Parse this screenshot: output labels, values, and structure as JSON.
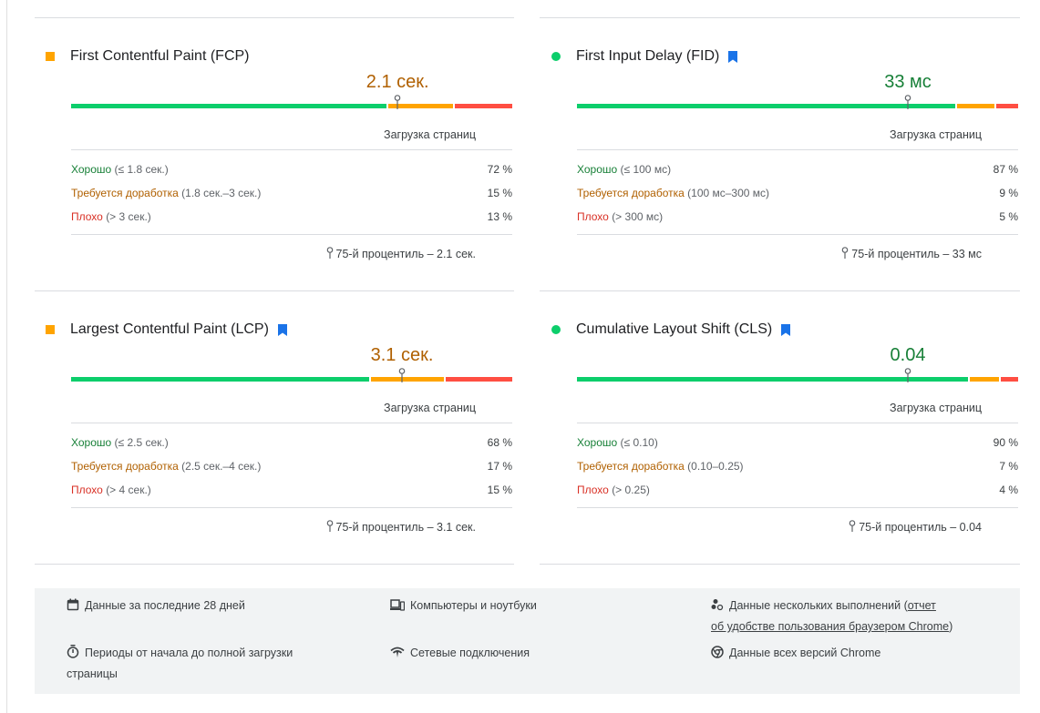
{
  "colors": {
    "good": "#0cce6b",
    "needs_improvement": "#ffa400",
    "poor": "#ff4e42",
    "bookmark": "#1a73e8"
  },
  "column_header": "Загрузка страниц",
  "cards": [
    {
      "title": "First Contentful Paint (FCP)",
      "status": "needs_improvement",
      "bookmark": false,
      "value": "2.1 сек.",
      "dist": {
        "good": 0.72,
        "needs_improvement": 0.15,
        "poor": 0.13,
        "marker": 0.74
      },
      "rows": [
        {
          "label": "Хорошо",
          "range": "(≤ 1.8 сек.)",
          "pct": "72 %"
        },
        {
          "label": "Требуется доработка",
          "range": "(1.8 сек.–3 сек.)",
          "pct": "15 %"
        },
        {
          "label": "Плохо",
          "range": "(> 3 сек.)",
          "pct": "13 %"
        }
      ],
      "percentile": "75-й процентиль – 2.1 сек."
    },
    {
      "title": "First Input Delay (FID)",
      "status": "good",
      "bookmark": true,
      "value": "33 мс",
      "dist": {
        "good": 0.87,
        "needs_improvement": 0.09,
        "poor": 0.05,
        "marker": 0.75
      },
      "rows": [
        {
          "label": "Хорошо",
          "range": "(≤ 100 мс)",
          "pct": "87 %"
        },
        {
          "label": "Требуется доработка",
          "range": "(100 мс–300 мс)",
          "pct": "9 %"
        },
        {
          "label": "Плохо",
          "range": "(> 300 мс)",
          "pct": "5 %"
        }
      ],
      "percentile": "75-й процентиль – 33 мс"
    },
    {
      "title": "Largest Contentful Paint (LCP)",
      "status": "needs_improvement",
      "bookmark": true,
      "value": "3.1 сек.",
      "dist": {
        "good": 0.68,
        "needs_improvement": 0.17,
        "poor": 0.15,
        "marker": 0.75
      },
      "rows": [
        {
          "label": "Хорошо",
          "range": "(≤ 2.5 сек.)",
          "pct": "68 %"
        },
        {
          "label": "Требуется доработка",
          "range": "(2.5 сек.–4 сек.)",
          "pct": "17 %"
        },
        {
          "label": "Плохо",
          "range": "(> 4 сек.)",
          "pct": "15 %"
        }
      ],
      "percentile": "75-й процентиль – 3.1 сек."
    },
    {
      "title": "Cumulative Layout Shift (CLS)",
      "status": "good",
      "bookmark": true,
      "value": "0.04",
      "dist": {
        "good": 0.9,
        "needs_improvement": 0.07,
        "poor": 0.04,
        "marker": 0.75
      },
      "rows": [
        {
          "label": "Хорошо",
          "range": "(≤ 0.10)",
          "pct": "90 %"
        },
        {
          "label": "Требуется доработка",
          "range": "(0.10–0.25)",
          "pct": "7 %"
        },
        {
          "label": "Плохо",
          "range": "(> 0.25)",
          "pct": "4 %"
        }
      ],
      "percentile": "75-й процентиль – 0.04"
    }
  ],
  "footer": {
    "period": "Данные за последние 28 дней",
    "devices": "Компьютеры и ноутбуки",
    "runs_prefix": "Данные нескольких выполнений (",
    "runs_link_1": "отчет",
    "runs_link_2": "об удобстве пользования браузером Chrome",
    "runs_suffix": ")",
    "durations_line1": "Периоды от начала до полной загрузки",
    "durations_line2": "страницы",
    "network": "Сетевые подключения",
    "versions": "Данные всех версий Chrome"
  }
}
